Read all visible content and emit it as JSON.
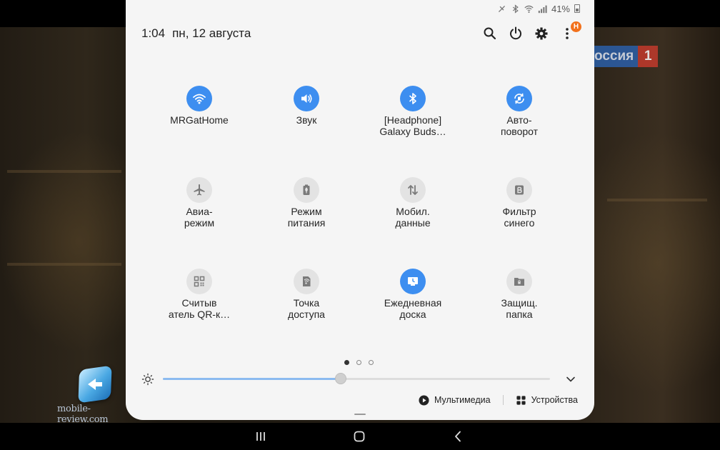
{
  "status_bar": {
    "battery": "41%"
  },
  "header": {
    "time": "1:04",
    "date": "пн, 12 августа",
    "notification_badge": "H"
  },
  "background": {
    "channel_name": "оссия",
    "channel_number": "1",
    "watermark": "mobile-review.com"
  },
  "tiles": [
    {
      "line1": "MRGatHome",
      "line2": "",
      "icon": "wifi-icon",
      "active": true
    },
    {
      "line1": "Звук",
      "line2": "",
      "icon": "sound-icon",
      "active": true
    },
    {
      "line1": "[Headphone]",
      "line2": "Galaxy Buds…",
      "icon": "bluetooth-icon",
      "active": true
    },
    {
      "line1": "Авто-",
      "line2": "поворот",
      "icon": "auto-rotate-icon",
      "active": true
    },
    {
      "line1": "Авиа-",
      "line2": "режим",
      "icon": "airplane-icon",
      "active": false
    },
    {
      "line1": "Режим",
      "line2": "питания",
      "icon": "power-mode-icon",
      "active": false
    },
    {
      "line1": "Мобил.",
      "line2": "данные",
      "icon": "mobile-data-icon",
      "active": false
    },
    {
      "line1": "Фильтр",
      "line2": "синего",
      "icon": "blue-light-filter-icon",
      "active": false
    },
    {
      "line1": "Считыв",
      "line2": "атель QR-к…",
      "icon": "qr-scanner-icon",
      "active": false
    },
    {
      "line1": "Точка",
      "line2": "доступа",
      "icon": "hotspot-icon",
      "active": false
    },
    {
      "line1": "Ежедневная",
      "line2": "доска",
      "icon": "daily-board-icon",
      "active": true
    },
    {
      "line1": "Защищ.",
      "line2": "папка",
      "icon": "secure-folder-icon",
      "active": false
    }
  ],
  "pagination": {
    "pages": 3,
    "current": 1
  },
  "brightness": {
    "level": 0.46
  },
  "bottom": {
    "media_label": "Мультимедиа",
    "devices_label": "Устройства"
  },
  "colors": {
    "accent": "#3d8ef0",
    "panel": "#f5f5f5",
    "badge": "#f2711c"
  }
}
